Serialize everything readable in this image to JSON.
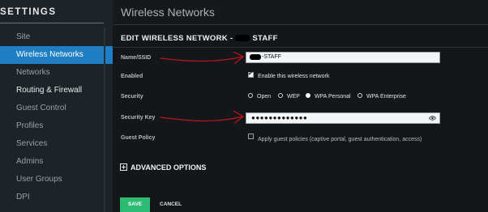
{
  "sidebar": {
    "title": "SETTINGS",
    "items": [
      {
        "label": "Site"
      },
      {
        "label": "Wireless Networks"
      },
      {
        "label": "Networks"
      },
      {
        "label": "Routing & Firewall"
      },
      {
        "label": "Guest Control"
      },
      {
        "label": "Profiles"
      },
      {
        "label": "Services"
      },
      {
        "label": "Admins"
      },
      {
        "label": "User Groups"
      },
      {
        "label": "DPI"
      }
    ]
  },
  "header": {
    "title": "Wireless Networks"
  },
  "form": {
    "title_prefix": "EDIT WIRELESS NETWORK -",
    "title_suffix": "STAFF",
    "name_label": "Name/SSID",
    "name_value": "-STAFF",
    "enabled_label": "Enabled",
    "enabled_text": "Enable this wireless network",
    "security_label": "Security",
    "security_options": [
      "Open",
      "WEP",
      "WPA Personal",
      "WPA Enterprise"
    ],
    "security_selected": "WPA Personal",
    "key_label": "Security Key",
    "key_value": "●●●●●●●●●●●●●",
    "guest_label": "Guest Policy",
    "guest_text": "Apply guest policies (captive portal, guest authentication, access)",
    "advanced_label": "ADVANCED OPTIONS",
    "save_label": "SAVE",
    "cancel_label": "CANCEL"
  },
  "colors": {
    "accent": "#1f7fc5",
    "save": "#2dbb74",
    "annotation": "#c0141a"
  }
}
